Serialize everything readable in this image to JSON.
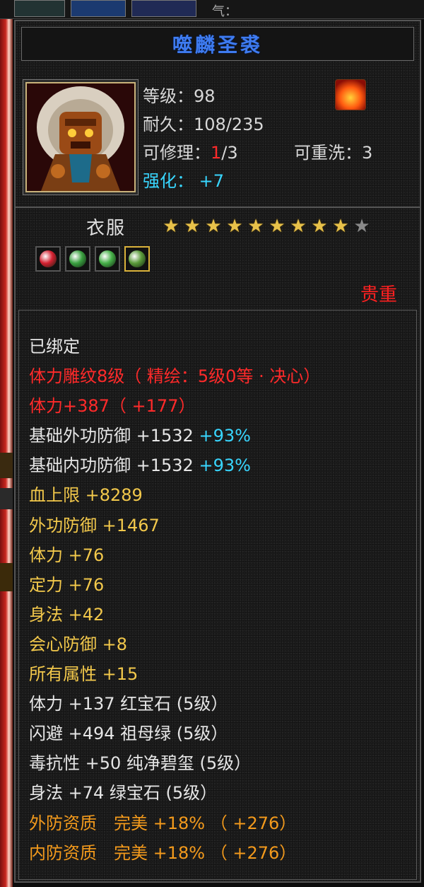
{
  "topbar": {
    "label": "气："
  },
  "item": {
    "name": "噬麟圣裘",
    "level_label": "等级：98",
    "durability_label": "耐久：108/235",
    "repair_prefix": "可修理：",
    "repair_used": "1",
    "repair_total": "/3",
    "reforge_label": "可重洗：3",
    "enhance_label": "强化：",
    "enhance_value": "+7",
    "slot": "衣服",
    "stars_filled": 9,
    "stars_total": 10,
    "rarity": "贵重",
    "gems": [
      {
        "icon": "red-gem-icon",
        "color": "#d42030"
      },
      {
        "icon": "green-gem-icon",
        "color": "#3aa040"
      },
      {
        "icon": "green-gem-icon",
        "color": "#46b048"
      },
      {
        "icon": "jade-gem-icon",
        "color": "#5a9a3a"
      }
    ]
  },
  "attributes": {
    "bound": "已绑定",
    "engrave": "体力雕纹8级（ 精绘：5级0等 · 决心）",
    "stamina_main": "体力+387（ +177）",
    "base_ext_def": "基础外功防御 +1532",
    "base_ext_def_pct": "+93%",
    "base_int_def": "基础内功防御 +1532",
    "base_int_def_pct": "+93%",
    "hp_max": "血上限 +8289",
    "ext_def": "外功防御 +1467",
    "stamina": "体力 +76",
    "focus": "定力 +76",
    "agility": "身法 +42",
    "crit_def": "会心防御 +8",
    "all_attr": "所有属性 +15",
    "gem1": "体力 +137 红宝石 (5级）",
    "gem2": "闪避 +494 祖母绿 (5级）",
    "gem3": "毒抗性 +50 纯净碧玺 (5级）",
    "gem4": "身法 +74 绿宝石 (5级）",
    "quality1": "外防资质　完美 +18% （ +276）",
    "quality2": "内防资质　完美 +18% （ +276）"
  },
  "colors": {
    "title": "#3e7bf0",
    "white": "#e6e6e6",
    "red": "#ff2a2a",
    "yellow": "#f2c84b",
    "orange": "#f39a1c",
    "cyan": "#38d6ff"
  }
}
